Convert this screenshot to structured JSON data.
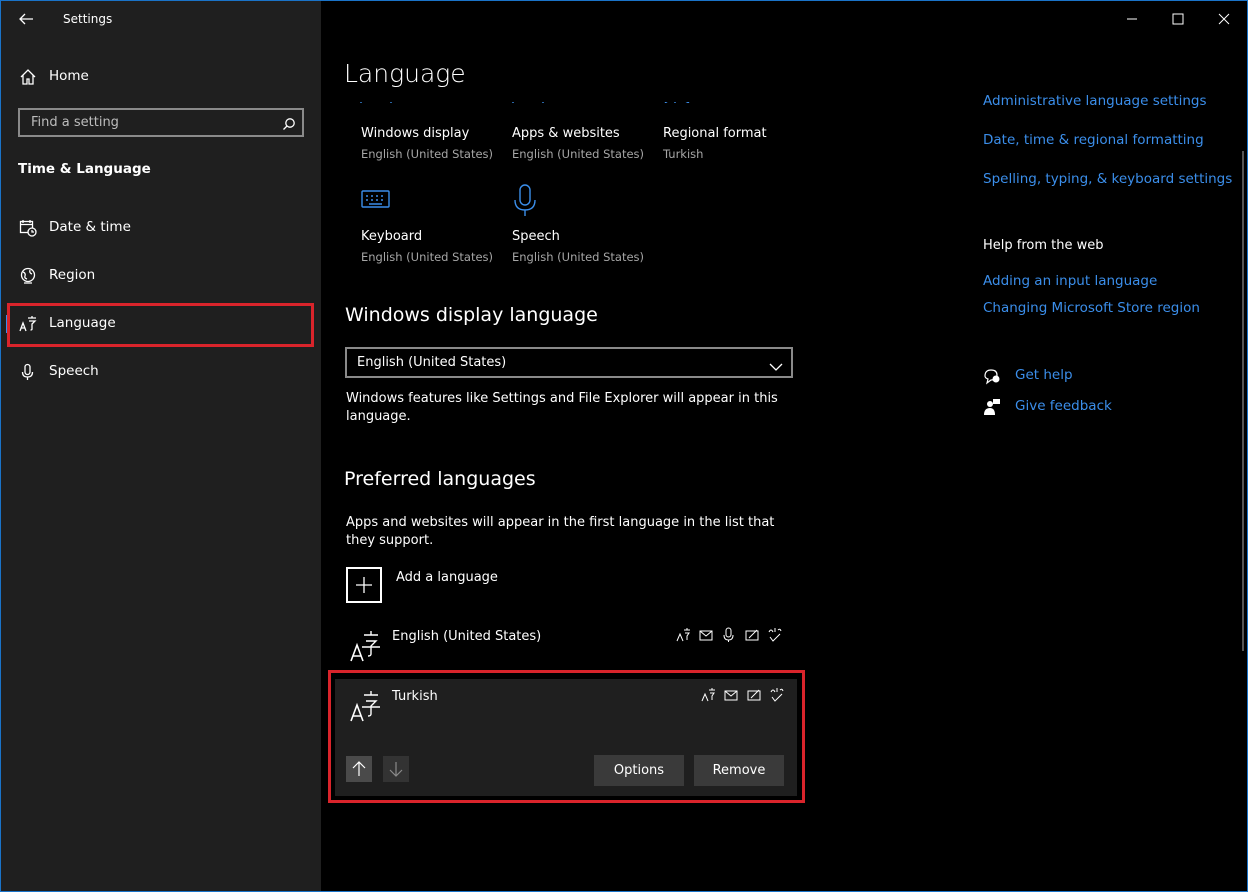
{
  "window": {
    "title": "Settings",
    "controls": {
      "minimize": "minimize-icon",
      "maximize": "maximize-icon",
      "close": "close-icon"
    }
  },
  "sidebar": {
    "home_label": "Home",
    "search_placeholder": "Find a setting",
    "section_title": "Time & Language",
    "items": [
      {
        "label": "Date & time",
        "icon": "calendar-clock-icon"
      },
      {
        "label": "Region",
        "icon": "globe-icon"
      },
      {
        "label": "Language",
        "icon": "language-icon",
        "selected": true
      },
      {
        "label": "Speech",
        "icon": "microphone-icon"
      }
    ]
  },
  "main": {
    "page_title": "Language",
    "tiles": [
      {
        "title": "Windows display",
        "sub": "English (United States)"
      },
      {
        "title": "Apps & websites",
        "sub": "English (United States)"
      },
      {
        "title": "Regional format",
        "sub": "Turkish"
      },
      {
        "title": "Keyboard",
        "sub": "English (United States)"
      },
      {
        "title": "Speech",
        "sub": "English (United States)"
      }
    ],
    "display_language": {
      "heading": "Windows display language",
      "selected": "English (United States)",
      "description": "Windows features like Settings and File Explorer will appear in this language."
    },
    "preferred": {
      "heading": "Preferred languages",
      "description": "Apps and websites will appear in the first language in the list that they support.",
      "add_label": "Add a language",
      "languages": [
        {
          "name": "English (United States)"
        },
        {
          "name": "Turkish"
        }
      ],
      "options_label": "Options",
      "remove_label": "Remove"
    }
  },
  "related": {
    "links": [
      "Administrative language settings",
      "Date, time & regional formatting",
      "Spelling, typing, & keyboard settings"
    ],
    "help_heading": "Help from the web",
    "help_links": [
      "Adding an input language",
      "Changing Microsoft Store region"
    ],
    "get_help": "Get help",
    "give_feedback": "Give feedback"
  },
  "colors": {
    "accent": "#3b8eea",
    "highlight": "#d9242b",
    "sidebar_bg": "#1f1f1f",
    "main_bg": "#000000"
  }
}
